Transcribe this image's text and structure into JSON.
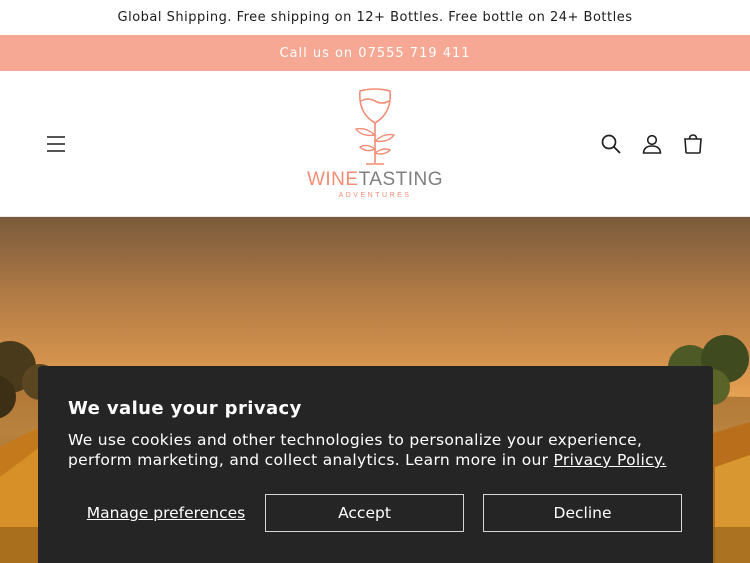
{
  "announcement": {
    "shipping_text": "Global Shipping. Free shipping on 12+ Bottles. Free bottle on 24+ Bottles",
    "call_text": "Call us on 07555 719 411"
  },
  "header": {
    "logo": {
      "word_wine": "WINE",
      "word_tasting": "TASTING",
      "tagline": "ADVENTURES",
      "colors": {
        "accent": "#f28c74",
        "grey": "#7f7f7f"
      }
    },
    "icons": [
      "menu-icon",
      "search-icon",
      "account-icon",
      "cart-icon"
    ]
  },
  "cookie_banner": {
    "title": "We value your privacy",
    "body": "We use cookies and other technologies to personalize your experience, perform marketing, and collect analytics. Learn more in our ",
    "policy_link": "Privacy Policy.",
    "manage_label": "Manage preferences",
    "accept_label": "Accept",
    "decline_label": "Decline"
  },
  "colors": {
    "announcement_bar": "#f6a895",
    "banner_bg": "#252525"
  }
}
